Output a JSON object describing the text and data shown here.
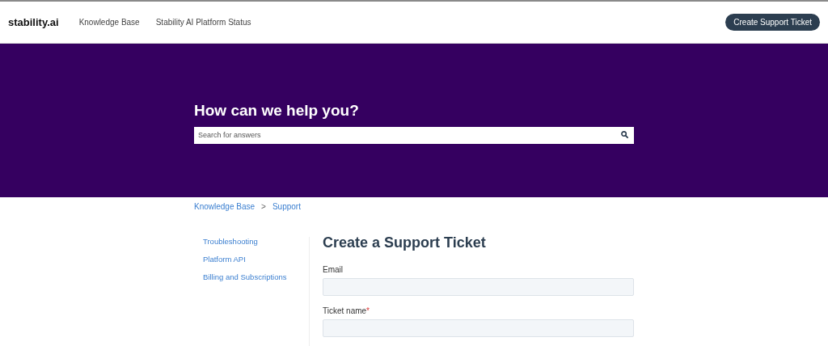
{
  "header": {
    "logo": "stability.ai",
    "nav": [
      "Knowledge Base",
      "Stability AI Platform Status"
    ],
    "cta": "Create Support Ticket"
  },
  "hero": {
    "title": "How can we help you?",
    "search": {
      "placeholder": "Search for answers"
    }
  },
  "breadcrumb": {
    "items": [
      "Knowledge Base",
      "Support"
    ],
    "separator": ">"
  },
  "sidebar": {
    "items": [
      "Troubleshooting",
      "Platform API",
      "Billing and Subscriptions"
    ]
  },
  "form": {
    "title": "Create a Support Ticket",
    "fields": [
      {
        "label": "Email"
      },
      {
        "label": "Ticket name",
        "required_mark": "*"
      }
    ]
  }
}
